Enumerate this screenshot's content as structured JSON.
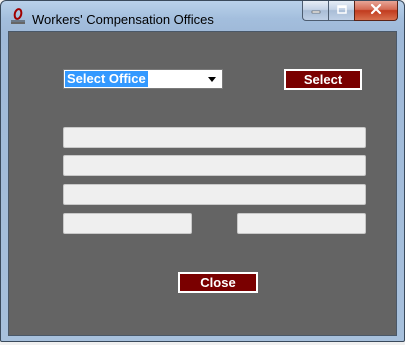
{
  "window": {
    "title": "Workers' Compensation Offices",
    "icon": "app-logo-icon",
    "controls": {
      "minimize": "minimize-icon",
      "maximize": "maximize-icon",
      "close": "close-icon"
    }
  },
  "form": {
    "office_select": {
      "value": "Select Office"
    },
    "select_button": "Select",
    "fields": [
      "",
      "",
      "",
      "",
      ""
    ],
    "close_button": "Close"
  },
  "colors": {
    "client_background": "#646464",
    "button_background": "#7a0000",
    "field_background": "#efefef",
    "selection_highlight": "#3399ff"
  }
}
